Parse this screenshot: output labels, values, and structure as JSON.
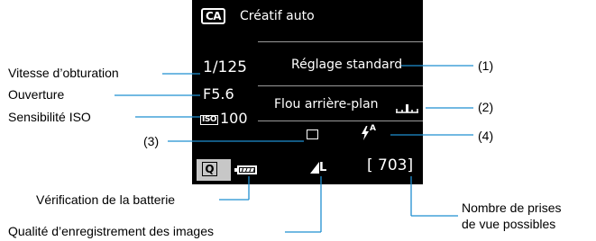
{
  "screen": {
    "mode_icon": "CA",
    "mode_name": "Créatif auto",
    "shutter": "1/125",
    "aperture": "F5.6",
    "iso_badge": "ISO",
    "iso_value": "100",
    "picture_style": "Réglage standard",
    "background_blur": "Flou arrière-plan",
    "quick_button": "Q",
    "quality": "L",
    "shots_remaining": "[ 703]",
    "flash_mode": "A"
  },
  "callouts": {
    "shutter": "Vitesse d’obturation",
    "aperture": "Ouverture",
    "iso": "Sensibilité ISO",
    "n1": "(1)",
    "n2": "(2)",
    "n3": "(3)",
    "n4": "(4)",
    "battery": "Vérification de la batterie",
    "quality": "Qualité d’enregistrement des images",
    "shots_line1": "Nombre de prises",
    "shots_line2": "de vue possibles"
  },
  "icons": [
    "mode-ca-icon",
    "blur-scale-icon",
    "single-shot-icon",
    "flash-auto-icon",
    "battery-icon",
    "image-quality-icon"
  ],
  "colors": {
    "screen_bg": "#000000",
    "leader": "#1f8fd1",
    "quick_button_bg": "#c7c7c7"
  }
}
